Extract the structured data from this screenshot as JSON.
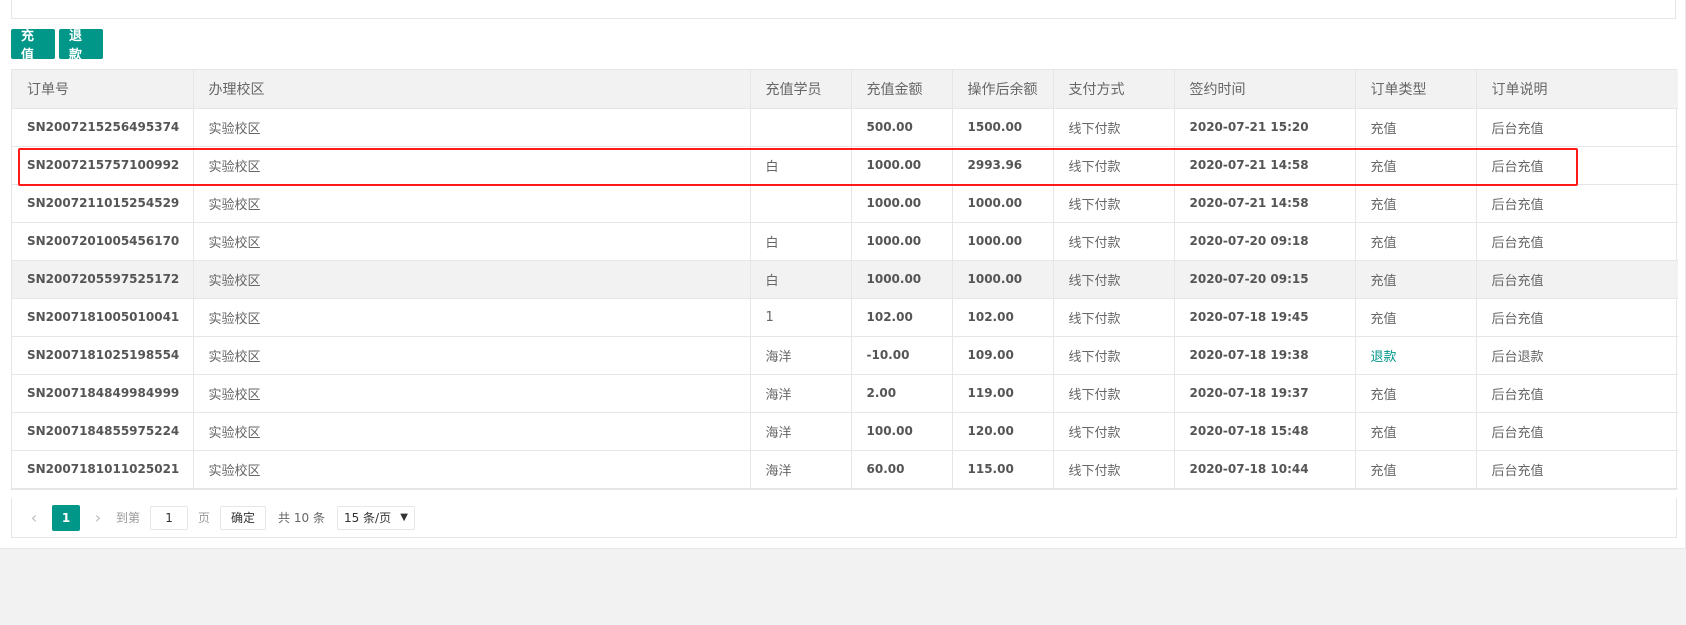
{
  "toolbar": {
    "recharge_label": "充值",
    "refund_label": "退款"
  },
  "table": {
    "headers": [
      "订单号",
      "办理校区",
      "充值学员",
      "充值金额",
      "操作后余额",
      "支付方式",
      "签约时间",
      "订单类型",
      "订单说明"
    ],
    "rows": [
      {
        "order_no": "SN2007215256495374",
        "campus": "实验校区",
        "student": "",
        "amount": "500.00",
        "balance": "1500.00",
        "pay_method": "线下付款",
        "sign_time": "2020-07-21 15:20",
        "order_type": "充值",
        "note": "后台充值"
      },
      {
        "order_no": "SN2007215757100992",
        "campus": "实验校区",
        "student": "白",
        "amount": "1000.00",
        "balance": "2993.96",
        "pay_method": "线下付款",
        "sign_time": "2020-07-21 14:58",
        "order_type": "充值",
        "note": "后台充值"
      },
      {
        "order_no": "SN2007211015254529",
        "campus": "实验校区",
        "student": "",
        "amount": "1000.00",
        "balance": "1000.00",
        "pay_method": "线下付款",
        "sign_time": "2020-07-21 14:58",
        "order_type": "充值",
        "note": "后台充值"
      },
      {
        "order_no": "SN2007201005456170",
        "campus": "实验校区",
        "student": "白",
        "amount": "1000.00",
        "balance": "1000.00",
        "pay_method": "线下付款",
        "sign_time": "2020-07-20 09:18",
        "order_type": "充值",
        "note": "后台充值"
      },
      {
        "order_no": "SN2007205597525172",
        "campus": "实验校区",
        "student": "白",
        "amount": "1000.00",
        "balance": "1000.00",
        "pay_method": "线下付款",
        "sign_time": "2020-07-20 09:15",
        "order_type": "充值",
        "note": "后台充值"
      },
      {
        "order_no": "SN2007181005010041",
        "campus": "实验校区",
        "student": "1",
        "amount": "102.00",
        "balance": "102.00",
        "pay_method": "线下付款",
        "sign_time": "2020-07-18 19:45",
        "order_type": "充值",
        "note": "后台充值"
      },
      {
        "order_no": "SN2007181025198554",
        "campus": "实验校区",
        "student": "海洋",
        "amount": "-10.00",
        "balance": "109.00",
        "pay_method": "线下付款",
        "sign_time": "2020-07-18 19:38",
        "order_type": "退款",
        "note": "后台退款"
      },
      {
        "order_no": "SN2007184849984999",
        "campus": "实验校区",
        "student": "海洋",
        "amount": "2.00",
        "balance": "119.00",
        "pay_method": "线下付款",
        "sign_time": "2020-07-18 19:37",
        "order_type": "充值",
        "note": "后台充值"
      },
      {
        "order_no": "SN2007184855975224",
        "campus": "实验校区",
        "student": "海洋",
        "amount": "100.00",
        "balance": "120.00",
        "pay_method": "线下付款",
        "sign_time": "2020-07-18 15:48",
        "order_type": "充值",
        "note": "后台充值"
      },
      {
        "order_no": "SN2007181011025021",
        "campus": "实验校区",
        "student": "海洋",
        "amount": "60.00",
        "balance": "115.00",
        "pay_method": "线下付款",
        "sign_time": "2020-07-18 10:44",
        "order_type": "充值",
        "note": "后台充值"
      }
    ]
  },
  "pagination": {
    "prev_icon": "‹",
    "current_page": "1",
    "next_icon": "›",
    "goto_label": "到第",
    "goto_value": "1",
    "page_unit": "页",
    "confirm_label": "确定",
    "total_label": "共 10 条",
    "page_size": "15 条/页"
  },
  "colors": {
    "accent": "#009688",
    "highlight": "#ff1a1a",
    "header_bg": "#f2f2f2"
  }
}
